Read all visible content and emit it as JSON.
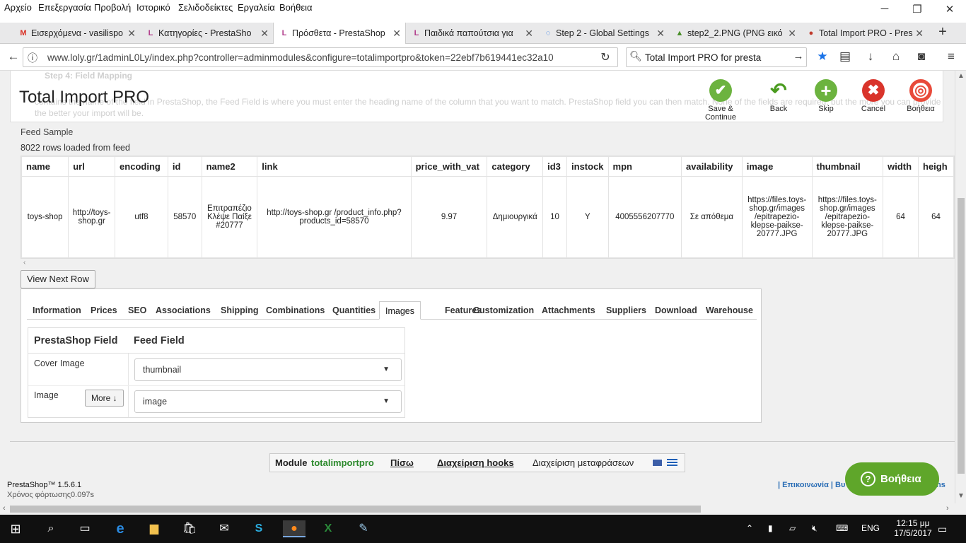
{
  "menu": [
    "Αρχείο",
    "Επεξεργασία",
    "Προβολή",
    "Ιστορικό",
    "Σελιδοδείκτες",
    "Εργαλεία",
    "Βοήθεια"
  ],
  "tabs": [
    {
      "label": "Εισερχόμενα - vasilispo",
      "icon": "gmail-icon"
    },
    {
      "label": "Κατηγορίες - PrestaSho",
      "icon": "loly-icon"
    },
    {
      "label": "Πρόσθετα - PrestaShop",
      "icon": "loly-icon"
    },
    {
      "label": "Παιδικά παπούτσια για",
      "icon": "loly-icon"
    },
    {
      "label": "Step 2 - Global Settings",
      "icon": "loading-icon"
    },
    {
      "label": "step2_2.PNG (PNG εικό",
      "icon": "image-icon"
    },
    {
      "label": "Total Import PRO - Pres",
      "icon": "prestashop-icon"
    }
  ],
  "nav": {
    "url": "www.loly.gr/1adminL0Ly/index.php?controller=adminmodules&configure=totalimportpro&token=22ebf7b619441ec32a10",
    "search": "Total Import PRO for presta"
  },
  "header": {
    "title": "Total Import PRO",
    "ghost_step": "Step 4: Field Mapping",
    "ghost_text": "contains the name of the field in PrestaShop, the Feed Field is where you must enter the heading name of the column that you want to match. PrestaShop field you can then match. None of the fields are required, but the more you can provide the better your import will be.",
    "buttons": [
      {
        "label": "Save & Continue",
        "color": "#6cb33f",
        "glyph": "✔"
      },
      {
        "label": "Back",
        "color": "#4a9b1f",
        "glyph": "↶"
      },
      {
        "label": "Skip",
        "color": "#6cb33f",
        "glyph": "+"
      },
      {
        "label": "Cancel",
        "color": "#d9342b",
        "glyph": "✖"
      },
      {
        "label": "Βοήθεια",
        "color": "#e84a3a",
        "glyph": "◎"
      }
    ]
  },
  "feed": {
    "label": "Feed Sample",
    "rows_loaded": "8022 rows loaded from feed",
    "columns": [
      "name",
      "url",
      "encoding",
      "id",
      "name2",
      "link",
      "price_with_vat",
      "category",
      "id3",
      "instock",
      "mpn",
      "availability",
      "image",
      "thumbnail",
      "width",
      "heigh"
    ],
    "row": [
      "toys-shop",
      "http://toys-shop.gr",
      "utf8",
      "58570",
      "Επιτραπέζιο Κλέψε Παίξε #20777",
      "http://toys-shop.gr /product_info.php?products_id=58570",
      "9.97",
      "Δημιουργικά",
      "10",
      "Y",
      "4005556207770",
      "Σε απόθεμα",
      "https://files.toys-shop.gr/images /epitrapezio-klepse-paikse-20777.JPG",
      "https://files.toys-shop.gr/images /epitrapezio-klepse-paikse-20777.JPG",
      "64",
      "64"
    ],
    "view_next": "View Next Row"
  },
  "product_tabs": [
    "Information",
    "Prices",
    "SEO",
    "Associations",
    "Shipping",
    "Combinations",
    "Quantities",
    "Images",
    "Features",
    "Customization",
    "Attachments",
    "Suppliers",
    "Download",
    "Warehouse"
  ],
  "active_tab": "Images",
  "mapping": {
    "head_field": "PrestaShop Field",
    "head_feed": "Feed Field",
    "cover_label": "Cover Image",
    "cover_value": "thumbnail",
    "image_label": "Image",
    "more_label": "More ↓",
    "image_value": "image"
  },
  "footer": {
    "module_prefix": "Module",
    "module_name": "totalimportpro",
    "back": "Πίσω",
    "hooks": "Διαχείριση hooks",
    "translations": "Διαχείριση μεταφράσεων",
    "version": "PrestaShop™ 1.5.6.1",
    "load_time": "Χρόνος φόρτωσης0.097s",
    "links": "| Επικοινωνία | Βυ",
    "links_tail": "ns",
    "help": "Βοήθεια"
  },
  "taskbar": {
    "lang": "ENG",
    "time": "12:15 μμ",
    "date": "17/5/2017"
  }
}
